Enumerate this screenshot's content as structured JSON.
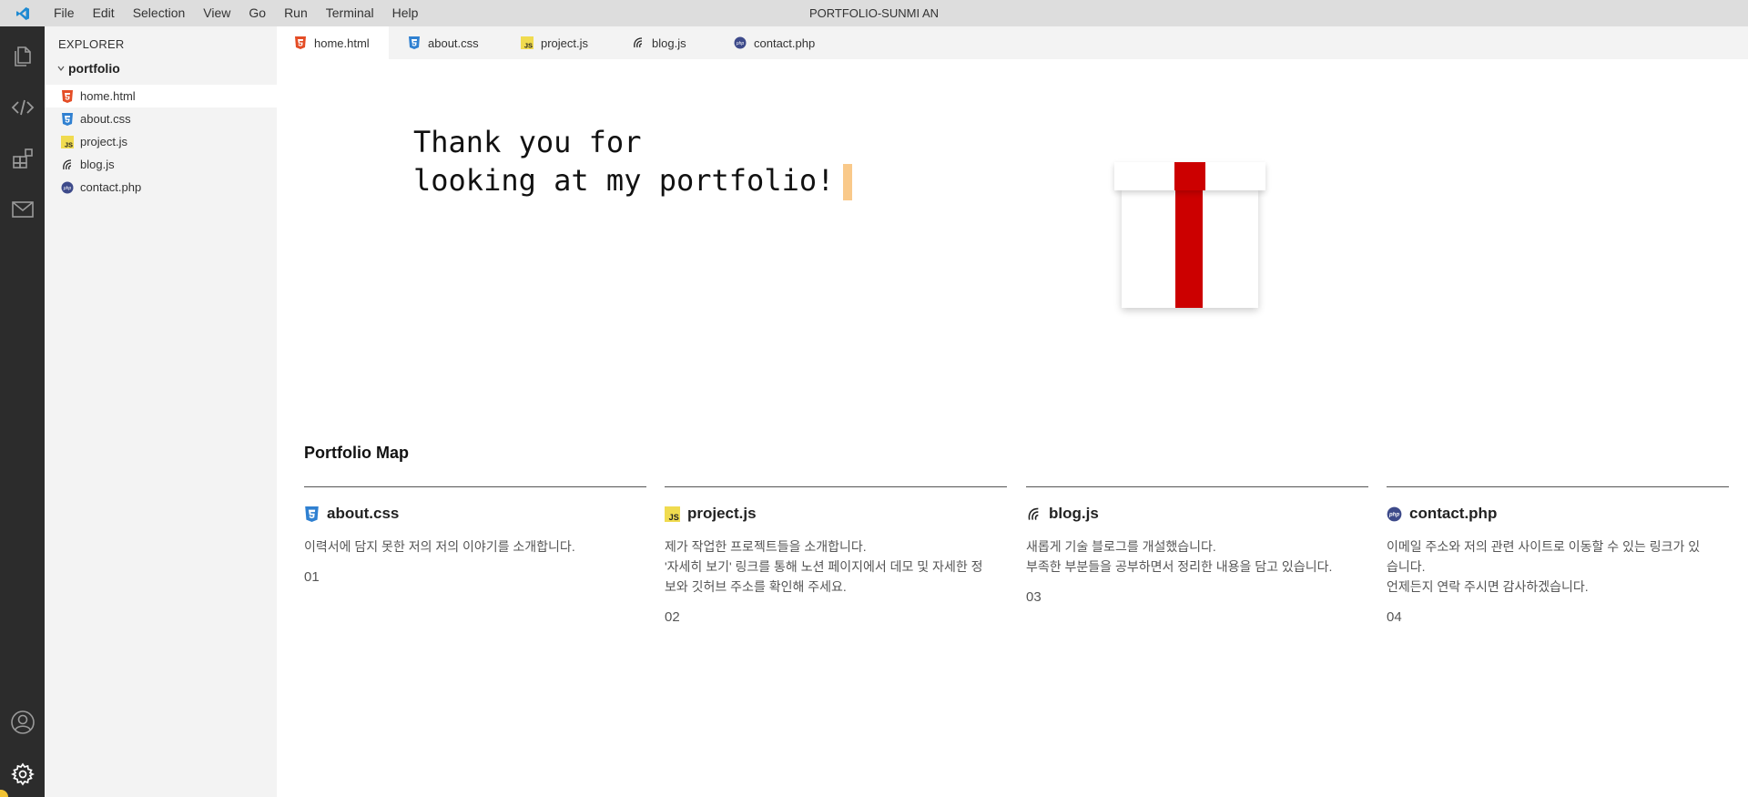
{
  "titlebar": {
    "window_title": "PORTFOLIO-SUNMI AN",
    "menu": [
      "File",
      "Edit",
      "Selection",
      "View",
      "Go",
      "Run",
      "Terminal",
      "Help"
    ]
  },
  "activity_bar": {
    "icons": [
      "files-icon",
      "code-icon",
      "extensions-icon",
      "mail-icon",
      "account-icon",
      "settings-gear-icon"
    ]
  },
  "explorer": {
    "header": "EXPLORER",
    "folder": "portfolio",
    "files": [
      {
        "name": "home.html",
        "icon": "html-icon",
        "active": true
      },
      {
        "name": "about.css",
        "icon": "css-icon",
        "active": false
      },
      {
        "name": "project.js",
        "icon": "js-icon",
        "active": false
      },
      {
        "name": "blog.js",
        "icon": "blog-icon",
        "active": false
      },
      {
        "name": "contact.php",
        "icon": "php-icon",
        "active": false
      }
    ]
  },
  "tabs": [
    {
      "label": "home.html",
      "icon": "html-icon",
      "active": true
    },
    {
      "label": "about.css",
      "icon": "css-icon",
      "active": false
    },
    {
      "label": "project.js",
      "icon": "js-icon",
      "active": false
    },
    {
      "label": "blog.js",
      "icon": "blog-icon",
      "active": false
    },
    {
      "label": "contact.php",
      "icon": "php-icon",
      "active": false
    }
  ],
  "hero": {
    "line1": "Thank you for",
    "line2": "looking at my portfolio!"
  },
  "portfolio_map": {
    "title": "Portfolio Map",
    "cards": [
      {
        "title": "about.css",
        "icon": "css-icon",
        "desc": [
          "이력서에 담지 못한 저의 저의 이야기를 소개합니다."
        ],
        "num": "01"
      },
      {
        "title": "project.js",
        "icon": "js-icon",
        "desc": [
          "제가 작업한 프로젝트들을 소개합니다.",
          "'자세히 보기' 링크를 통해 노션 페이지에서 데모 및 자세한 정",
          "보와 깃허브 주소를 확인해 주세요."
        ],
        "num": "02"
      },
      {
        "title": "blog.js",
        "icon": "blog-icon",
        "desc": [
          "새롭게 기술 블로그를 개설했습니다.",
          "부족한 부분들을 공부하면서 정리한 내용을 담고 있습니다."
        ],
        "num": "03"
      },
      {
        "title": "contact.php",
        "icon": "php-icon",
        "desc": [
          "이메일 주소와 저의 관련 사이트로 이동할 수 있는 링크가 있",
          "습니다.",
          "언제든지 연락 주시면 감사하겠습니다."
        ],
        "num": "04"
      }
    ]
  },
  "colors": {
    "activity_bg": "#2c2c2c",
    "sidebar_bg": "#f3f3f3",
    "titlebar_bg": "#dddddd",
    "ribbon": "#cc0000",
    "cursor": "#f9c98a",
    "html_icon": "#e44d26",
    "css_icon": "#2f80d1",
    "js_icon": "#f0db4f",
    "php_icon": "#3d4a8a"
  }
}
